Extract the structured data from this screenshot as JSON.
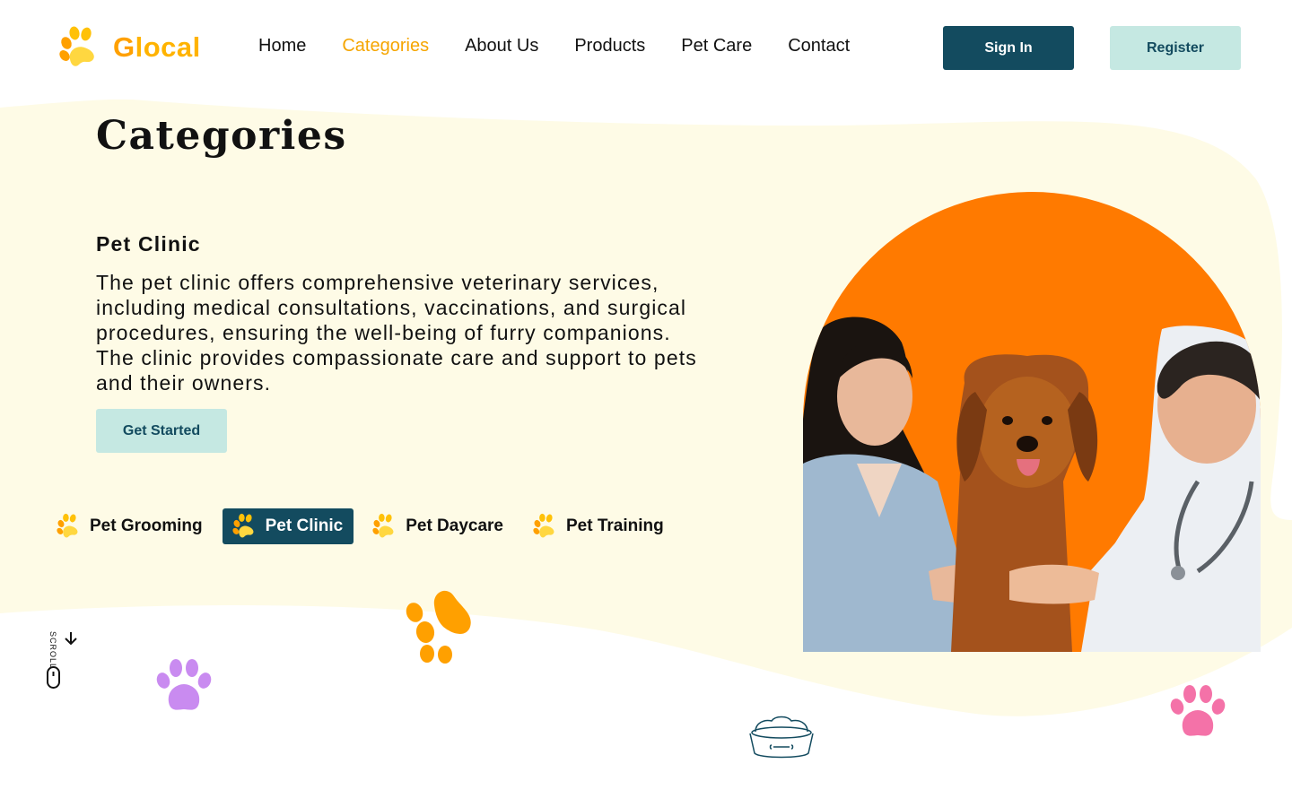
{
  "brand": {
    "name": "Glocal",
    "first_letter": "G",
    "rest": "local"
  },
  "nav": {
    "items": [
      {
        "label": "Home"
      },
      {
        "label": "Categories",
        "active": true
      },
      {
        "label": "About Us"
      },
      {
        "label": "Products"
      },
      {
        "label": "Pet Care"
      },
      {
        "label": "Contact"
      }
    ]
  },
  "auth": {
    "signin_label": "Sign In",
    "register_label": "Register"
  },
  "main": {
    "title": "Categories",
    "section_title": "Pet Clinic",
    "description": "The pet clinic offers comprehensive veterinary services, including medical consultations, vaccinations, and surgical procedures, ensuring the well-being of furry companions. The clinic provides compassionate care and support to pets and their owners.",
    "cta_label": "Get Started"
  },
  "category_tabs": [
    {
      "label": "Pet Grooming"
    },
    {
      "label": "Pet Clinic",
      "active": true
    },
    {
      "label": "Pet Daycare"
    },
    {
      "label": "Pet Training"
    }
  ],
  "scroll_label": "SCROLL",
  "icons": {
    "logo": "paw-icon",
    "tab": "paw-icon",
    "scroll": "mouse-icon",
    "scroll_arrow": "arrow-down-icon",
    "decor": [
      "paw-icon-orange",
      "paw-icon-purple",
      "paw-icon-pink",
      "pet-bowl-icon"
    ]
  },
  "colors": {
    "brand": "#FFB300",
    "primary_dark": "#134B5F",
    "accent_light": "#C5E8E2",
    "active_nav": "#F5A500",
    "hero_bg": "#FF7A00",
    "background_blob": "#FEFBE6",
    "paw_purple": "#C98BF0",
    "paw_pink": "#F472A8"
  }
}
